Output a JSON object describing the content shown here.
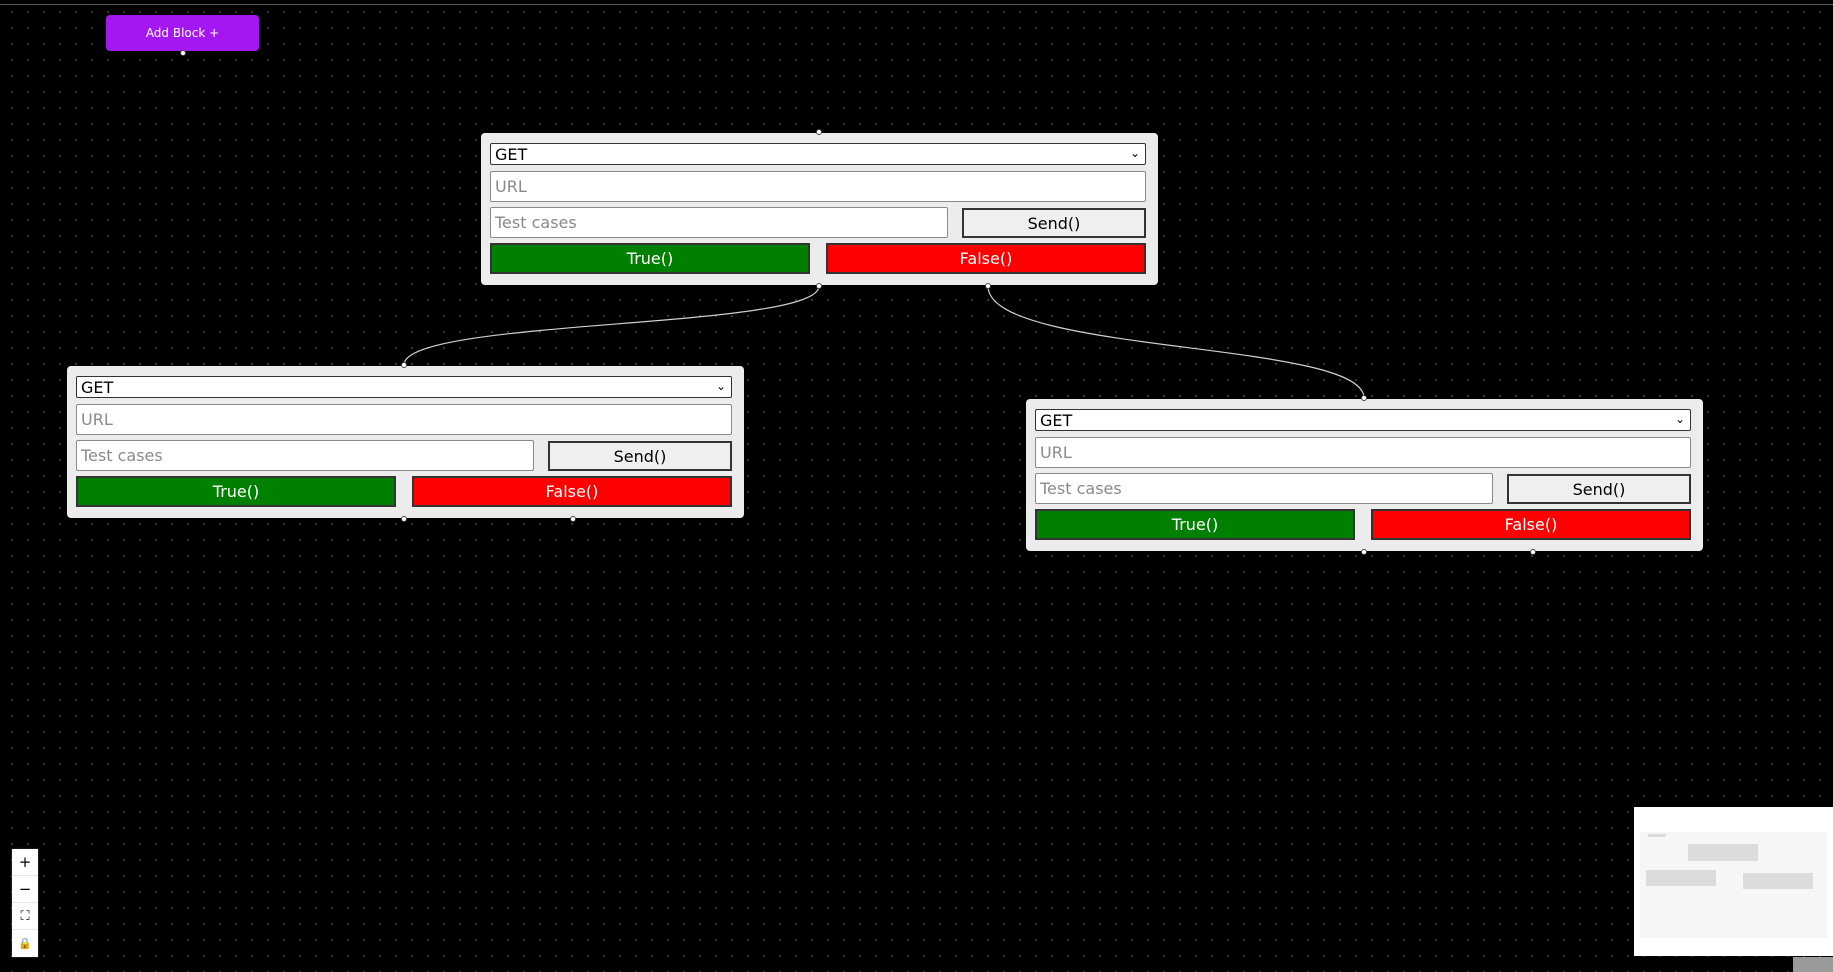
{
  "toolbar": {
    "add_block_label": "Add Block +"
  },
  "blocks": [
    {
      "method": "GET",
      "url_placeholder": "URL",
      "tests_placeholder": "Test cases",
      "send_label": "Send()",
      "true_label": "True()",
      "false_label": "False()"
    },
    {
      "method": "GET",
      "url_placeholder": "URL",
      "tests_placeholder": "Test cases",
      "send_label": "Send()",
      "true_label": "True()",
      "false_label": "False()"
    },
    {
      "method": "GET",
      "url_placeholder": "URL",
      "tests_placeholder": "Test cases",
      "send_label": "Send()",
      "true_label": "True()",
      "false_label": "False()"
    }
  ],
  "controls": {
    "zoom_in_icon": "+",
    "zoom_out_icon": "−",
    "fit_view_icon": "⛶",
    "lock_icon": "🔒"
  },
  "colors": {
    "add_block": "#a417f0",
    "true_button": "#008000",
    "false_button": "#ff0000"
  }
}
